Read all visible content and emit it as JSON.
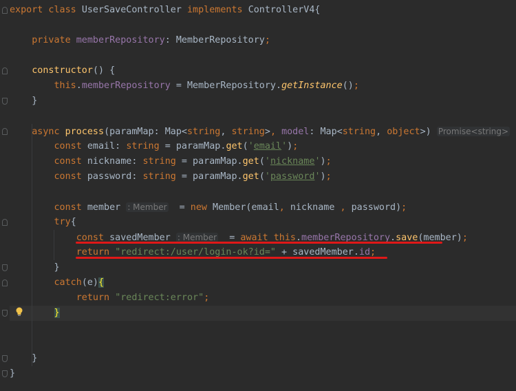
{
  "editor": {
    "lines": [
      {
        "segments": [
          {
            "t": "export class ",
            "c": "kw"
          },
          {
            "t": "UserSaveController "
          },
          {
            "t": "implements ",
            "c": "kw"
          },
          {
            "t": "ControllerV4{"
          }
        ]
      },
      {
        "segments": []
      },
      {
        "segments": [
          {
            "t": "    "
          },
          {
            "t": "private ",
            "c": "kw"
          },
          {
            "t": "memberRepository",
            "c": "fld"
          },
          {
            "t": ": MemberRepository"
          },
          {
            "t": ";",
            "c": "kw"
          }
        ]
      },
      {
        "segments": []
      },
      {
        "segments": [
          {
            "t": "    "
          },
          {
            "t": "constructor",
            "c": "fn"
          },
          {
            "t": "() {"
          }
        ]
      },
      {
        "segments": [
          {
            "t": "        "
          },
          {
            "t": "this",
            "c": "kw"
          },
          {
            "t": "."
          },
          {
            "t": "memberRepository",
            "c": "fld"
          },
          {
            "t": " = MemberRepository."
          },
          {
            "t": "getInstance",
            "c": "fni"
          },
          {
            "t": "()"
          },
          {
            "t": ";",
            "c": "kw"
          }
        ]
      },
      {
        "segments": [
          {
            "t": "    }"
          }
        ]
      },
      {
        "segments": []
      },
      {
        "segments": [
          {
            "t": "    "
          },
          {
            "t": "async ",
            "c": "kw"
          },
          {
            "t": "process",
            "c": "fn"
          },
          {
            "t": "(paramMap: Map<"
          },
          {
            "t": "string",
            "c": "kw"
          },
          {
            "t": ", "
          },
          {
            "t": "string",
            "c": "kw"
          },
          {
            "t": ">"
          },
          {
            "t": ", ",
            "c": "kw"
          },
          {
            "t": "model",
            "c": "fld"
          },
          {
            "t": ": Map<"
          },
          {
            "t": "string",
            "c": "kw"
          },
          {
            "t": ", "
          },
          {
            "t": "object",
            "c": "kw"
          },
          {
            "t": ">) "
          },
          {
            "t": "Promise<string>",
            "c": "hint"
          }
        ]
      },
      {
        "segments": [
          {
            "t": "        "
          },
          {
            "t": "const ",
            "c": "kw"
          },
          {
            "t": "email: "
          },
          {
            "t": "string",
            "c": "kw"
          },
          {
            "t": " = paramMap."
          },
          {
            "t": "get",
            "c": "fn"
          },
          {
            "t": "("
          },
          {
            "t": "'",
            "c": "str"
          },
          {
            "t": "email",
            "c": "str-u"
          },
          {
            "t": "'",
            "c": "str"
          },
          {
            "t": ")"
          },
          {
            "t": ";",
            "c": "kw"
          }
        ]
      },
      {
        "segments": [
          {
            "t": "        "
          },
          {
            "t": "const ",
            "c": "kw"
          },
          {
            "t": "nickname: "
          },
          {
            "t": "string",
            "c": "kw"
          },
          {
            "t": " = paramMap."
          },
          {
            "t": "get",
            "c": "fn"
          },
          {
            "t": "("
          },
          {
            "t": "'",
            "c": "str"
          },
          {
            "t": "nickname",
            "c": "str-u"
          },
          {
            "t": "'",
            "c": "str"
          },
          {
            "t": ")"
          },
          {
            "t": ";",
            "c": "kw"
          }
        ]
      },
      {
        "segments": [
          {
            "t": "        "
          },
          {
            "t": "const ",
            "c": "kw"
          },
          {
            "t": "password: "
          },
          {
            "t": "string",
            "c": "kw"
          },
          {
            "t": " = paramMap."
          },
          {
            "t": "get",
            "c": "fn"
          },
          {
            "t": "("
          },
          {
            "t": "'",
            "c": "str"
          },
          {
            "t": "password",
            "c": "str-u"
          },
          {
            "t": "'",
            "c": "str"
          },
          {
            "t": ")"
          },
          {
            "t": ";",
            "c": "kw"
          }
        ]
      },
      {
        "segments": []
      },
      {
        "segments": [
          {
            "t": "        "
          },
          {
            "t": "const ",
            "c": "kw"
          },
          {
            "t": "member "
          },
          {
            "t": ": Member",
            "c": "hint"
          },
          {
            "t": "  = "
          },
          {
            "t": "new ",
            "c": "kw"
          },
          {
            "t": "Member(email"
          },
          {
            "t": ", ",
            "c": "kw"
          },
          {
            "t": "nickname "
          },
          {
            "t": ", ",
            "c": "kw"
          },
          {
            "t": "password)"
          },
          {
            "t": ";",
            "c": "kw"
          }
        ]
      },
      {
        "segments": [
          {
            "t": "        "
          },
          {
            "t": "try",
            "c": "kw"
          },
          {
            "t": "{"
          }
        ]
      },
      {
        "segments": [
          {
            "t": "            "
          },
          {
            "t": "const ",
            "c": "kw"
          },
          {
            "t": "savedMember "
          },
          {
            "t": ": Member",
            "c": "hint"
          },
          {
            "t": "  = "
          },
          {
            "t": "await this",
            "c": "kw"
          },
          {
            "t": "."
          },
          {
            "t": "memberRepository",
            "c": "fld"
          },
          {
            "t": "."
          },
          {
            "t": "save",
            "c": "fn"
          },
          {
            "t": "(member)"
          },
          {
            "t": ";",
            "c": "kw"
          }
        ]
      },
      {
        "segments": [
          {
            "t": "            "
          },
          {
            "t": "return ",
            "c": "kw"
          },
          {
            "t": "\"redirect:/user/login-ok?id=\"",
            "c": "str"
          },
          {
            "t": " + savedMember."
          },
          {
            "t": "id",
            "c": "fld"
          },
          {
            "t": ";",
            "c": "kw"
          }
        ]
      },
      {
        "segments": [
          {
            "t": "        }"
          }
        ]
      },
      {
        "segments": [
          {
            "t": "        "
          },
          {
            "t": "catch",
            "c": "kw"
          },
          {
            "t": "(e)"
          },
          {
            "t": "{",
            "c": "brace-hl"
          }
        ]
      },
      {
        "segments": [
          {
            "t": "            "
          },
          {
            "t": "return ",
            "c": "kw"
          },
          {
            "t": "\"redirect:error\"",
            "c": "str"
          },
          {
            "t": ";",
            "c": "kw"
          }
        ]
      },
      {
        "segments": [
          {
            "t": "        "
          },
          {
            "t": "}",
            "c": "brace-hl"
          }
        ]
      },
      {
        "segments": []
      },
      {
        "segments": []
      },
      {
        "segments": [
          {
            "t": "    }"
          }
        ]
      },
      {
        "segments": [
          {
            "t": "}"
          }
        ]
      }
    ],
    "colors": {
      "background": "#2b2b2b",
      "keyword": "#cc7832",
      "field": "#9876aa",
      "function": "#ffc66d",
      "string": "#6a8759",
      "default": "#a9b7c6",
      "annotation_underline": "#e01818"
    },
    "icons": [
      "fold-marker-icon",
      "lightbulb-icon"
    ]
  }
}
